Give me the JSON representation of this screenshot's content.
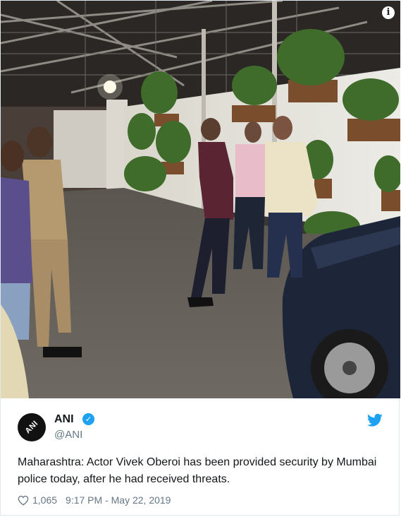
{
  "photo": {
    "alt_icon": "info-icon",
    "info_glyph": "i"
  },
  "author": {
    "avatar_text": "ANI",
    "display_name": "ANI",
    "verified_glyph": "✓",
    "handle": "@ANI"
  },
  "tweet": {
    "text": "Maharashtra: Actor Vivek Oberoi has been provided security by Mumbai police today, after he had received threats."
  },
  "footer": {
    "likes": "1,065",
    "timestamp": "9:17 PM - May 22, 2019"
  },
  "colors": {
    "twitter_blue": "#1da1f2",
    "meta_gray": "#657786",
    "text": "#14171a"
  },
  "icons": [
    "info-icon",
    "verified-icon",
    "twitter-bird-icon",
    "heart-icon"
  ]
}
